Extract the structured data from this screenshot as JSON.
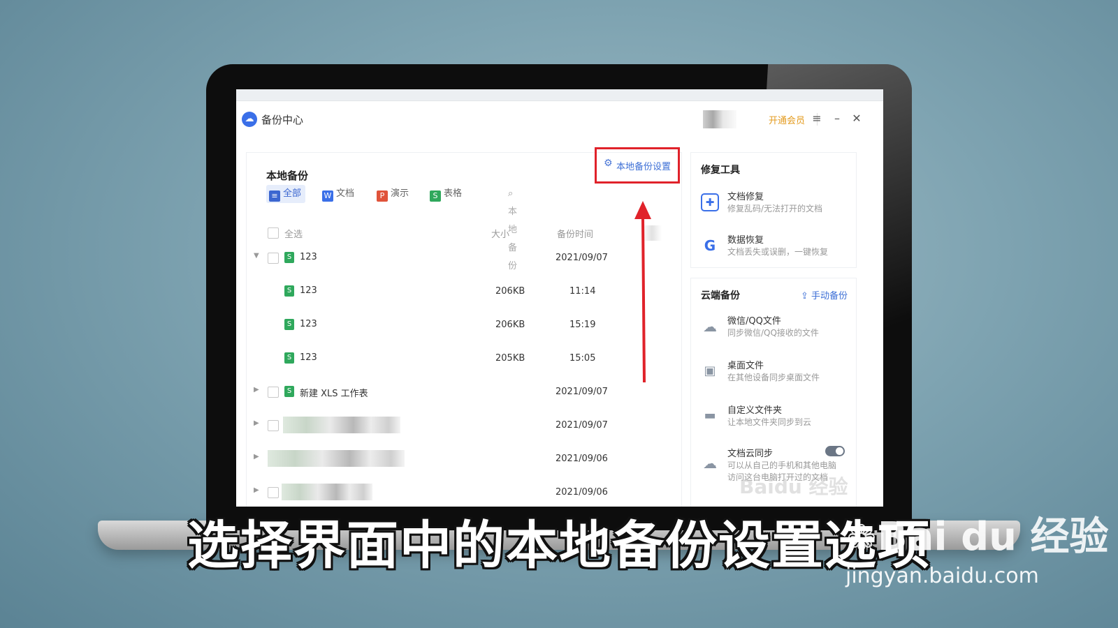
{
  "app": {
    "title": "备份中心",
    "vip_link": "开通会员",
    "menu_icon": "≡",
    "minimize_icon": "–",
    "close_icon": "✕"
  },
  "local_backup": {
    "title": "本地备份",
    "settings_button": "本地备份设置",
    "filters": [
      {
        "label": "全部",
        "icon": "≡",
        "color": "#3b66d0"
      },
      {
        "label": "文档",
        "icon": "W",
        "color": "#3a6fe8"
      },
      {
        "label": "演示",
        "icon": "P",
        "color": "#e0533a"
      },
      {
        "label": "表格",
        "icon": "S",
        "color": "#2fa85c"
      }
    ],
    "search_placeholder": "本地备份",
    "columns": {
      "select_all": "全选",
      "size": "大小",
      "time": "备份时间"
    },
    "rows": [
      {
        "name": "123",
        "size": "",
        "time": "2021/09/07",
        "expanded": true
      },
      {
        "name": "123",
        "size": "206KB",
        "time": "11:14"
      },
      {
        "name": "123",
        "size": "206KB",
        "time": "15:19"
      },
      {
        "name": "123",
        "size": "205KB",
        "time": "15:05"
      },
      {
        "name": "新建 XLS 工作表",
        "size": "",
        "time": "2021/09/07"
      },
      {
        "name": "",
        "size": "",
        "time": "2021/09/07"
      },
      {
        "name": "",
        "size": "",
        "time": "2021/09/06"
      },
      {
        "name": "",
        "size": "",
        "time": "2021/09/06"
      }
    ]
  },
  "repair_tools": {
    "title": "修复工具",
    "items": [
      {
        "name": "文档修复",
        "desc": "修复乱码/无法打开的文档",
        "icon": "document-repair-icon"
      },
      {
        "name": "数据恢复",
        "desc": "文档丢失或误删，一键恢复",
        "icon": "data-recovery-icon"
      }
    ]
  },
  "cloud_backup": {
    "title": "云端备份",
    "manual_button": "手动备份",
    "items": [
      {
        "name": "微信/QQ文件",
        "desc": "同步微信/QQ接收的文件",
        "icon": "chat-icon"
      },
      {
        "name": "桌面文件",
        "desc": "在其他设备同步桌面文件",
        "icon": "desktop-icon"
      },
      {
        "name": "自定义文件夹",
        "desc": "让本地文件夹同步到云",
        "icon": "folder-icon"
      },
      {
        "name": "文档云同步",
        "desc": "可以从自己的手机和其他电脑",
        "desc2": "访问这台电脑打开过的文档",
        "icon": "cloud-upload-icon"
      }
    ]
  },
  "caption": "选择界面中的本地备份设置选项",
  "watermark": {
    "logo": "Bai du 经验",
    "url": "jingyan.baidu.com",
    "screen_logo": "Baidu 经验"
  },
  "colors": {
    "accent": "#3d6fd6",
    "highlight": "#e0222a",
    "vip": "#e39a1d",
    "xls": "#2fa85c"
  }
}
